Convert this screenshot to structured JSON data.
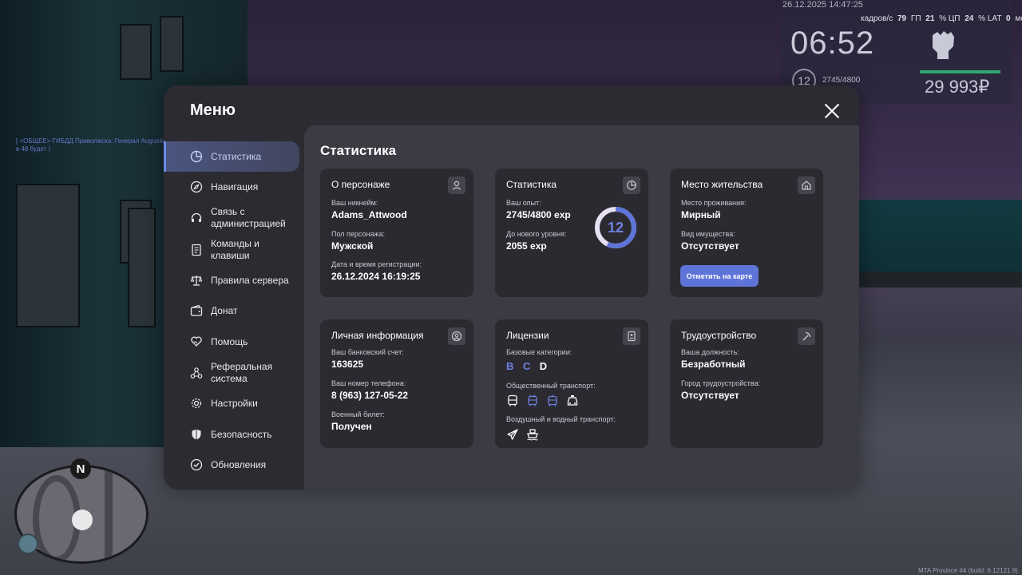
{
  "hud": {
    "datetime": "26.12.2025 14:47:25",
    "perf": {
      "fps_label": "кадров/с",
      "fps": "79",
      "gpu_label": "ГП",
      "gpu": "21",
      "cpu_label": "% ЦП",
      "cpu": "24",
      "lat_label": "% LAT",
      "lat": "0",
      "lat_unit": "мс"
    },
    "clock": "06:52",
    "level": "12",
    "exp": "2745/4800",
    "money": "29 993₽",
    "build": "MTA Province #4 (build: 6.12121.9)"
  },
  "chat": [
    "[ <ОБЩЕЕ> ГИБДД Приволжска: Генерал Augustine_Mo...",
    "в 48 будет )"
  ],
  "menu": {
    "title": "Меню",
    "sidebar": [
      {
        "label": "Статистика",
        "icon": "pie-chart-icon",
        "active": true
      },
      {
        "label": "Навигация",
        "icon": "compass-icon"
      },
      {
        "label": "Связь с администрацией",
        "icon": "headset-icon"
      },
      {
        "label": "Команды и клавиши",
        "icon": "document-icon"
      },
      {
        "label": "Правила сервера",
        "icon": "scales-icon"
      },
      {
        "label": "Донат",
        "icon": "wallet-icon"
      },
      {
        "label": "Помощь",
        "icon": "heart-hand-icon"
      },
      {
        "label": "Реферальная система",
        "icon": "network-icon"
      },
      {
        "label": "Настройки",
        "icon": "gear-icon"
      },
      {
        "label": "Безопасность",
        "icon": "shield-icon"
      },
      {
        "label": "Обновления",
        "icon": "check-circle-icon"
      }
    ],
    "content_title": "Статистика",
    "cards": {
      "character": {
        "title": "О персонаже",
        "nickname_label": "Ваш никнейм:",
        "nickname": "Adams_Attwood",
        "gender_label": "Пол персонажа:",
        "gender": "Мужской",
        "reg_label": "Дата и время регистрации:",
        "reg": "26.12.2024 16:19:25"
      },
      "stats": {
        "title": "Статистика",
        "exp_label": "Ваш опыт:",
        "exp": "2745/4800 exp",
        "next_label": "До нового уровня:",
        "next": "2055 exp",
        "level": "12",
        "progress": 0.571875
      },
      "residence": {
        "title": "Место жительства",
        "place_label": "Место проживания:",
        "place": "Мирный",
        "property_label": "Вид имущества:",
        "property": "Отсутствует",
        "button": "Отметить на карте"
      },
      "personal": {
        "title": "Личная информация",
        "bank_label": "Ваш банковский счет:",
        "bank": "163625",
        "phone_label": "Ваш номер телефона:",
        "phone": "8 (963) 127-05-22",
        "military_label": "Военный билет:",
        "military": "Получен"
      },
      "licenses": {
        "title": "Лицензии",
        "base_label": "Базовые категории:",
        "categories": [
          {
            "name": "B",
            "owned": true
          },
          {
            "name": "C",
            "owned": true
          },
          {
            "name": "D",
            "owned": false
          }
        ],
        "public_label": "Общественный транспорт:",
        "air_label": "Воздушный и водный транспорт:"
      },
      "job": {
        "title": "Трудоустройство",
        "position_label": "Ваша должность:",
        "position": "Безработный",
        "city_label": "Город трудоустройства:",
        "city": "Отсутствует"
      }
    }
  },
  "colors": {
    "accent": "#6e82e0",
    "panel": "#2c2b32",
    "content": "#3c3b44",
    "card": "#2b2a31"
  }
}
